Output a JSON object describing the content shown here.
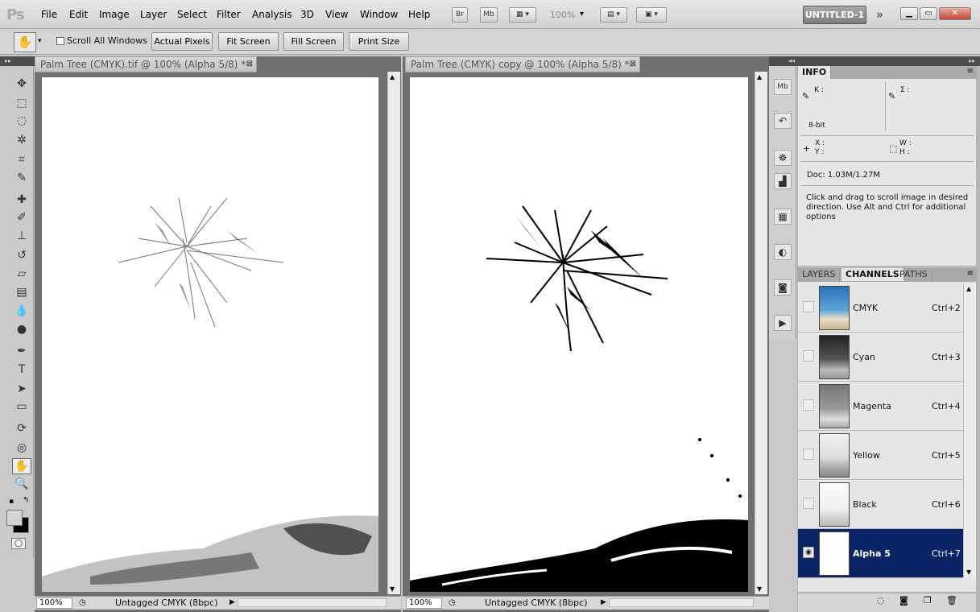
{
  "app": {
    "logo": "Ps",
    "document_button": "UNTITLED-1"
  },
  "menu": [
    "File",
    "Edit",
    "Image",
    "Layer",
    "Select",
    "Filter",
    "Analysis",
    "3D",
    "View",
    "Window",
    "Help"
  ],
  "appbar": {
    "bridge": "Br",
    "mini_bridge": "Mb",
    "zoom": "100%"
  },
  "options": {
    "scroll_all_label": "Scroll All Windows",
    "actual_pixels": "Actual Pixels",
    "fit_screen": "Fit Screen",
    "fill_screen": "Fill Screen",
    "print_size": "Print Size"
  },
  "documents": [
    {
      "title": "Palm Tree (CMYK).tif @ 100% (Alpha 5/8) *",
      "zoom": "100%",
      "status": "Untagged CMYK (8bpc)"
    },
    {
      "title": "Palm Tree (CMYK) copy @ 100% (Alpha 5/8) *",
      "zoom": "100%",
      "status": "Untagged CMYK (8bpc)"
    }
  ],
  "info_panel": {
    "tab": "INFO",
    "k_label": "K :",
    "sigma_label": "Σ :",
    "bitdepth": "8-bit",
    "x_label": "X :",
    "y_label": "Y :",
    "w_label": "W :",
    "h_label": "H :",
    "doc": "Doc: 1.03M/1.27M",
    "hint": "Click and drag to scroll image in desired direction.  Use Alt and Ctrl for additional options"
  },
  "channels_panel": {
    "tabs": [
      "LAYERS",
      "CHANNELS",
      "PATHS"
    ],
    "channels": [
      {
        "name": "CMYK",
        "shortcut": "Ctrl+2"
      },
      {
        "name": "Cyan",
        "shortcut": "Ctrl+3"
      },
      {
        "name": "Magenta",
        "shortcut": "Ctrl+4"
      },
      {
        "name": "Yellow",
        "shortcut": "Ctrl+5"
      },
      {
        "name": "Black",
        "shortcut": "Ctrl+6"
      },
      {
        "name": "Alpha 5",
        "shortcut": "Ctrl+7"
      }
    ]
  },
  "colors": {
    "selection": "#0a2466",
    "panel_bg": "#e6e6e6",
    "canvas": "#ffffff"
  }
}
